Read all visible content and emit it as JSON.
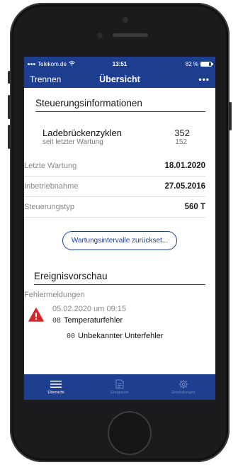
{
  "status": {
    "carrier": "Telekom.de",
    "time": "13:51",
    "battery": "82 %",
    "battery_level": 0.82
  },
  "nav": {
    "back_label": "Trennen",
    "title": "Übersicht",
    "more_label": "•••"
  },
  "control_info": {
    "title": "Steuerungsinformationen",
    "cycles_label": "Ladebrückenzyklen",
    "cycles_value": "352",
    "since_label": "seit letzter Wartung",
    "since_value": "152",
    "rows": [
      {
        "label": "Letzte Wartung",
        "value": "18.01.2020"
      },
      {
        "label": "Inbetriebnahme",
        "value": "27.05.2016"
      },
      {
        "label": "Steuerungstyp",
        "value": "560 T"
      }
    ],
    "reset_button": "Wartungsintervalle zurückset..."
  },
  "events": {
    "title": "Ereignisvorschau",
    "subheading": "Fehlermeldungen",
    "items": [
      {
        "time": "05.02.2020 um 09:15",
        "code": "08",
        "error": "Temperaturfehler",
        "sub_code": "00",
        "sub_error": "Unbekannter Unterfehler"
      }
    ]
  },
  "tabs": [
    {
      "label": "Übersicht",
      "icon": "list-icon",
      "active": true
    },
    {
      "label": "Ereignisse",
      "icon": "document-icon",
      "active": false
    },
    {
      "label": "Einstellungen",
      "icon": "gear-icon",
      "active": false
    }
  ],
  "colors": {
    "brand": "#1e3f8f",
    "warning": "#d7262b"
  }
}
